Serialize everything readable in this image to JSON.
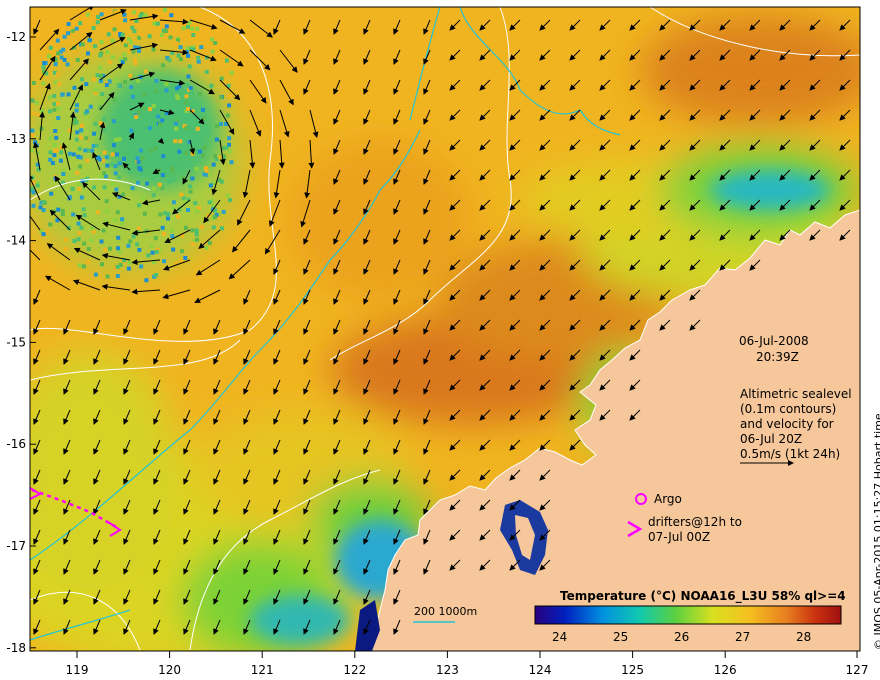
{
  "map": {
    "date": "06-Jul-2008",
    "time": "20:39Z",
    "altimetry_lines": [
      "Altimetric sealevel",
      "(0.1m contours)",
      "and velocity for",
      "06-Jul 20Z",
      "0.5m/s (1kt 24h)"
    ],
    "argo_label": "Argo",
    "drifters_lines": [
      "drifters@12h to",
      "07-Jul 00Z"
    ],
    "depth_label": "200  1000m",
    "colorbar_title": "Temperature (°C) NOAA16_L3U 58% ql>=4",
    "colorbar_ticks": [
      "24",
      "25",
      "26",
      "27",
      "28"
    ],
    "credit": "© IMOS 05-Apr-2015 01:15:27 Hobart time",
    "x_ticks": [
      "119",
      "120",
      "121",
      "122",
      "123",
      "124",
      "125",
      "126",
      "127"
    ],
    "y_ticks": [
      "-12",
      "-13",
      "-14",
      "-15",
      "-16",
      "-17",
      "-18"
    ],
    "colors": {
      "sea_warm": "#f5a81e",
      "sea_hot": "#d9781a",
      "sea_mid": "#e8d020",
      "sea_cool": "#9ad830",
      "sea_cold": "#1fb2c8",
      "land": "#f6c79a",
      "contour": "#ffffff",
      "isobath": "#22c4d6",
      "drifter": "#ff00ff"
    }
  }
}
